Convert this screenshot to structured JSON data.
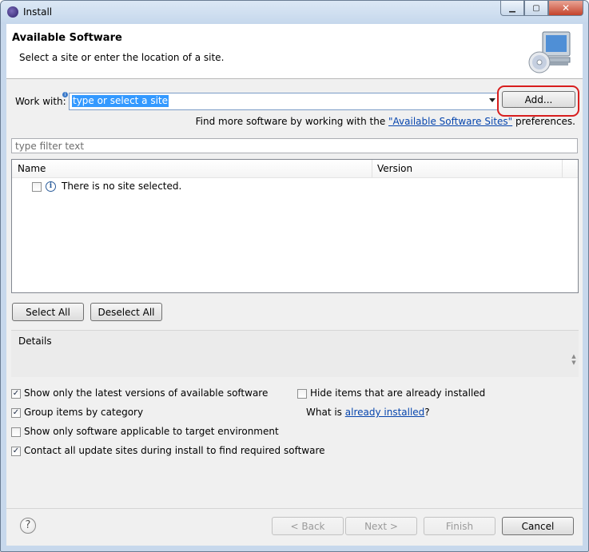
{
  "window": {
    "title": "Install",
    "controls": {
      "minimize": "▁",
      "maximize": "▢",
      "close": "✕"
    }
  },
  "header": {
    "title": "Available Software",
    "description": "Select a site or enter the location of a site.",
    "image_icon": "computer-cd-icon"
  },
  "work_with": {
    "label": "Work with:",
    "value": "type or select a site",
    "add_button": "Add...",
    "info_glyph": "i"
  },
  "find_more": {
    "prefix": "Find more software by working with the ",
    "link": "\"Available Software Sites\"",
    "suffix": " preferences."
  },
  "filter": {
    "placeholder": "type filter text"
  },
  "tree": {
    "columns": [
      "Name",
      "Version"
    ],
    "rows": [
      {
        "name": "There is no site selected.",
        "version": "",
        "checked": false,
        "icon": "info-icon"
      }
    ]
  },
  "selection_buttons": {
    "select_all": "Select All",
    "deselect_all": "Deselect All"
  },
  "details": {
    "label": "Details"
  },
  "options": {
    "latest_versions": {
      "label": "Show only the latest versions of available software",
      "checked": true
    },
    "group_by_category": {
      "label": "Group items by category",
      "checked": true
    },
    "target_env": {
      "label": "Show only software applicable to target environment",
      "checked": false
    },
    "contact_sites": {
      "label": "Contact all update sites during install to find required software",
      "checked": true
    },
    "hide_installed": {
      "label": "Hide items that are already installed",
      "checked": false
    },
    "what_is": {
      "prefix": "What is ",
      "link": "already installed",
      "suffix": "?"
    }
  },
  "footer": {
    "help_glyph": "?",
    "back": "< Back",
    "next": "Next >",
    "finish": "Finish",
    "cancel": "Cancel"
  },
  "colors": {
    "highlight_ring": "#d81e1e",
    "link": "#0645ad",
    "selection": "#3399ff",
    "titlebar": "#c5d7ec"
  }
}
